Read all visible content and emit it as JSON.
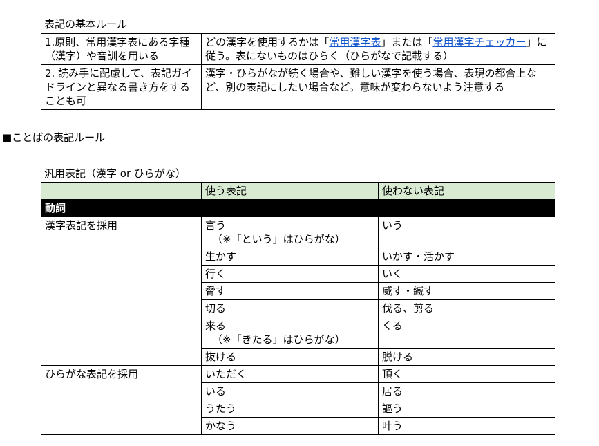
{
  "heading1": "表記の基本ルール",
  "rules": [
    {
      "left": "1.原則、常用漢字表にある字種（漢字）や音訓を用いる",
      "right_pre": "どの漢字を使用するかは「",
      "link1": "常用漢字表",
      "right_mid": "」または「",
      "link2": "常用漢字チェッカー",
      "right_post": "」に従う。表にないものはひらく（ひらがなで記載する）"
    },
    {
      "left": "2. 読み手に配慮して、表記ガイドラインと異なる書き方をすることも可",
      "right": "漢字・ひらがなが続く場合や、難しい漢字を使う場合、表現の都合上など、別の表記にしたい場合など。意味が変わらないよう注意する"
    }
  ],
  "heading2": "■ことばの表記ルール",
  "heading3": "汎用表記（漢字 or ひらがな）",
  "table": {
    "col_use": "使う表記",
    "col_avoid": "使わない表記",
    "section": "動詞",
    "group1": "漢字表記を採用",
    "group2": "ひらがな表記を採用",
    "rows1": [
      {
        "use": "言う",
        "note": "（※「という」はひらがな）",
        "avoid": "いう"
      },
      {
        "use": "生かす",
        "avoid": "いかす・活かす"
      },
      {
        "use": "行く",
        "avoid": "いく"
      },
      {
        "use": "脅す",
        "avoid": "威す・縅す"
      },
      {
        "use": "切る",
        "avoid": "伐る、剪る"
      },
      {
        "use": "来る",
        "note": "（※「きたる」はひらがな）",
        "avoid": "くる"
      },
      {
        "use": "抜ける",
        "avoid": "脱ける"
      }
    ],
    "rows2": [
      {
        "use": "いただく",
        "avoid": "頂く"
      },
      {
        "use": "いる",
        "avoid": "居る"
      },
      {
        "use": "うたう",
        "avoid": "謳う"
      },
      {
        "use": "かなう",
        "avoid": "叶う"
      }
    ]
  }
}
